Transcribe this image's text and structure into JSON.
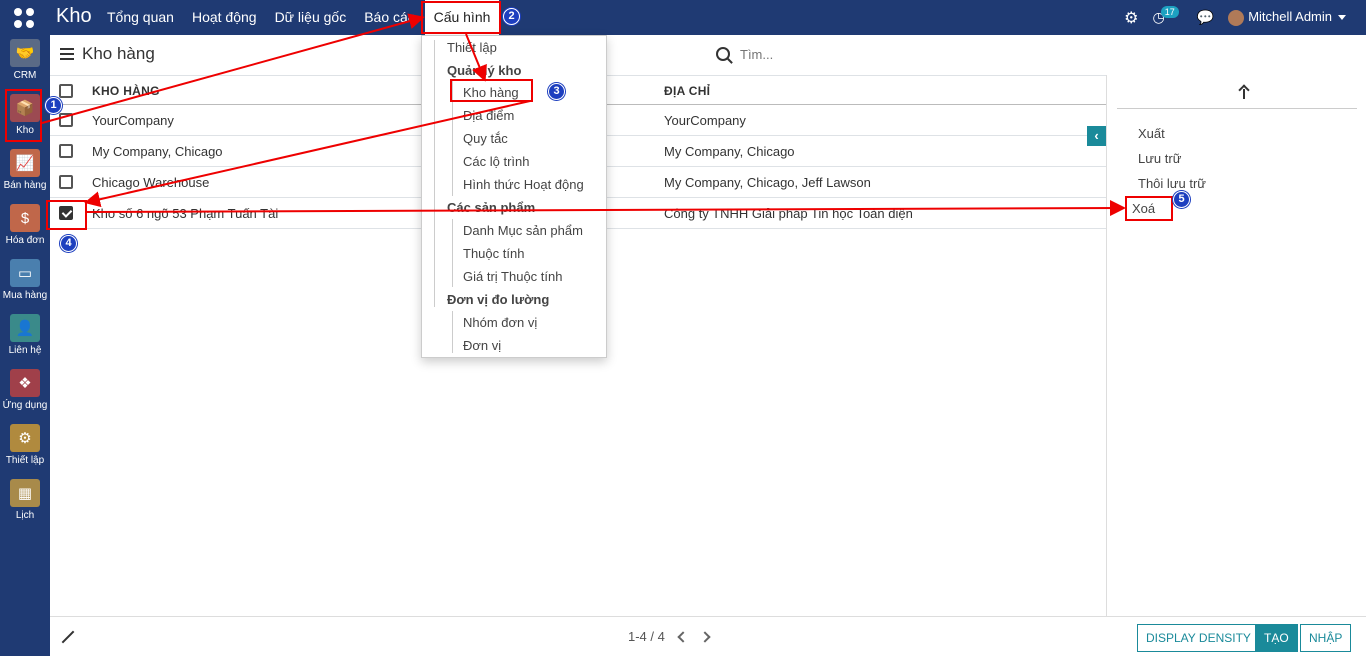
{
  "topbar": {
    "brand": "Kho",
    "menu": [
      "Tổng quan",
      "Hoạt động",
      "Dữ liệu gốc",
      "Báo cáo",
      "Cấu hình"
    ],
    "notification_count": "17",
    "user": "Mitchell Admin"
  },
  "sidebar": {
    "apps": [
      {
        "label": "CRM",
        "color": "#5a6a86"
      },
      {
        "label": "Kho",
        "color": "#9c4a52"
      },
      {
        "label": "Bán hàng",
        "color": "#c0674a"
      },
      {
        "label": "Hóa đơn",
        "color": "#c0674a"
      },
      {
        "label": "Mua hàng",
        "color": "#4a7fae"
      },
      {
        "label": "Liên hệ",
        "color": "#3a8a8a"
      },
      {
        "label": "Ứng dụng",
        "color": "#a0404a"
      },
      {
        "label": "Thiết lập",
        "color": "#b08a3e"
      },
      {
        "label": "Lịch",
        "color": "#a88a4a"
      }
    ]
  },
  "control_panel": {
    "title": "Kho hàng",
    "search_placeholder": "Tìm..."
  },
  "table": {
    "headers": [
      "KHO HÀNG",
      "ĐỊA CHỈ"
    ],
    "rows": [
      {
        "name": "YourCompany",
        "address": "YourCompany",
        "checked": false
      },
      {
        "name": "My Company, Chicago",
        "address": "My Company, Chicago",
        "checked": false
      },
      {
        "name": "Chicago Warehouse",
        "address": "My Company, Chicago, Jeff Lawson",
        "checked": false
      },
      {
        "name": "Kho số 6 ngõ 53 Phạm Tuấn Tài",
        "address": "Công ty TNHH Giải pháp Tin học Toàn diện",
        "checked": true
      }
    ]
  },
  "dropdown": {
    "items": [
      {
        "label": "Thiết lập",
        "type": "item",
        "level": 1
      },
      {
        "label": "Quản lý kho",
        "type": "header"
      },
      {
        "label": "Kho hàng",
        "type": "item",
        "level": 2
      },
      {
        "label": "Địa điểm",
        "type": "item",
        "level": 2
      },
      {
        "label": "Quy tắc",
        "type": "item",
        "level": 2
      },
      {
        "label": "Các lộ trình",
        "type": "item",
        "level": 2
      },
      {
        "label": "Hình thức Hoạt động",
        "type": "item",
        "level": 2
      },
      {
        "label": "Các sản phẩm",
        "type": "header"
      },
      {
        "label": "Danh Mục sản phẩm",
        "type": "item",
        "level": 2
      },
      {
        "label": "Thuộc tính",
        "type": "item",
        "level": 2
      },
      {
        "label": "Giá trị Thuộc tính",
        "type": "item",
        "level": 2
      },
      {
        "label": "Đơn vị đo lường",
        "type": "header"
      },
      {
        "label": "Nhóm đơn vị",
        "type": "item",
        "level": 2
      },
      {
        "label": "Đơn vị",
        "type": "item",
        "level": 2
      }
    ]
  },
  "sidepanel": {
    "actions": [
      "Xuất",
      "Lưu trữ",
      "Thôi lưu trữ",
      "Xoá"
    ]
  },
  "bottombar": {
    "pager": "1-4 / 4",
    "display_density": "DISPLAY DENSITY",
    "create": "TẠO",
    "import": "NHẬP"
  },
  "annotations": [
    "1",
    "2",
    "3",
    "4",
    "5"
  ],
  "colors": {
    "nav": "#1f3a73",
    "accent": "#1a8a9a",
    "highlight": "#e00000",
    "badge": "#1d3fbf"
  }
}
